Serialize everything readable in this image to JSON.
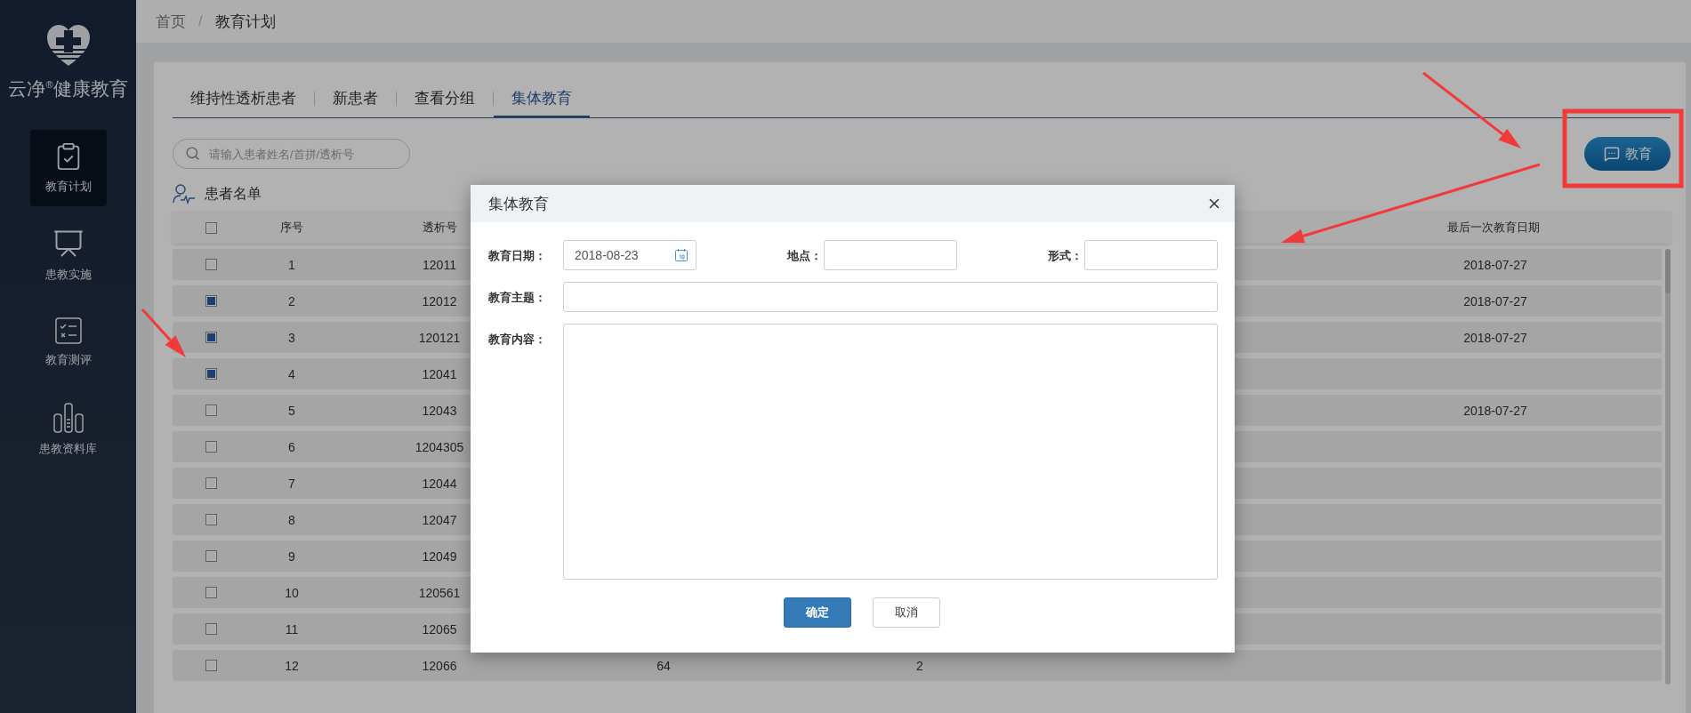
{
  "sidebar": {
    "brand": "云净$^{®}$健康教育",
    "items": [
      {
        "label": "教育计划",
        "selected": true
      },
      {
        "label": "患教实施",
        "selected": false
      },
      {
        "label": "教育测评",
        "selected": false
      },
      {
        "label": "患教资料库",
        "selected": false
      }
    ]
  },
  "breadcrumb": [
    "首页",
    "/",
    "教育计划"
  ],
  "tabs": [
    {
      "label": "维持性透析患者",
      "selected": false
    },
    {
      "label": "新患者",
      "selected": false
    },
    {
      "label": "查看分组",
      "selected": false
    },
    {
      "label": "集体教育",
      "selected": true
    }
  ],
  "search": {
    "placeholder": "请输入患者姓名/首拼/透析号"
  },
  "education_button": "教育",
  "list_title": "患者名单",
  "table": {
    "header": {
      "checked": false,
      "seq": "序号",
      "dialysis_no": "透析号",
      "last_education_date": "最后一次教育日期"
    },
    "rows": [
      {
        "checked": false,
        "seq": "1",
        "dialysis_no": "12011",
        "last_education_date": "2018-07-27"
      },
      {
        "checked": true,
        "seq": "2",
        "dialysis_no": "12012",
        "last_education_date": "2018-07-27"
      },
      {
        "checked": true,
        "seq": "3",
        "dialysis_no": "120121",
        "last_education_date": "2018-07-27"
      },
      {
        "checked": true,
        "seq": "4",
        "dialysis_no": "12041"
      },
      {
        "checked": false,
        "seq": "5",
        "dialysis_no": "12043",
        "last_education_date": "2018-07-27"
      },
      {
        "checked": false,
        "seq": "6",
        "dialysis_no": "1204305"
      },
      {
        "checked": false,
        "seq": "7",
        "dialysis_no": "12044"
      },
      {
        "checked": false,
        "seq": "8",
        "dialysis_no": "12047"
      },
      {
        "checked": false,
        "seq": "9",
        "dialysis_no": "12049"
      },
      {
        "checked": false,
        "seq": "10",
        "dialysis_no": "120561"
      },
      {
        "checked": false,
        "seq": "11",
        "dialysis_no": "12065"
      },
      {
        "checked": false,
        "seq": "12",
        "dialysis_no": "12066",
        "column_3": "64",
        "column_4": "2"
      }
    ]
  },
  "dialog": {
    "title": "集体教育",
    "fields": [
      {
        "kind": "date",
        "label": "教育日期：",
        "value": "2018-08-23"
      },
      {
        "kind": "text",
        "label": "地点："
      },
      {
        "kind": "text",
        "label": "形式："
      },
      {
        "kind": "wide",
        "label": "教育主题："
      },
      {
        "kind": "textarea",
        "label": "教育内容："
      }
    ],
    "buttons": [
      {
        "kind": "primary",
        "label": "确定"
      },
      {
        "kind": "default",
        "label": "取消"
      }
    ]
  }
}
